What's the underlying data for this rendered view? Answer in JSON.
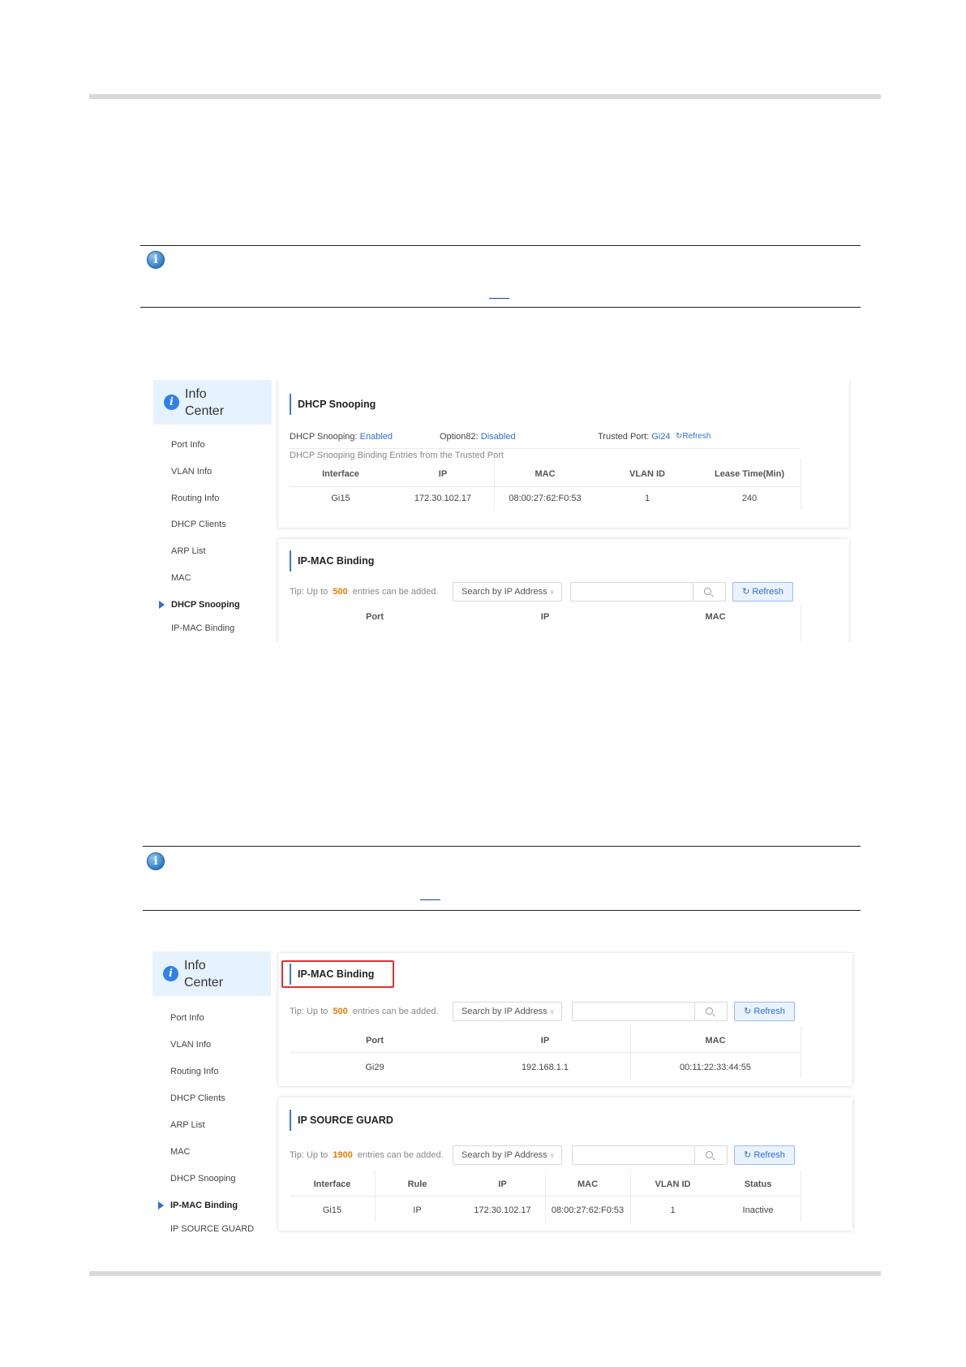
{
  "shot1": {
    "sidebar": {
      "title": "Info Center",
      "items": [
        "Port Info",
        "VLAN Info",
        "Routing Info",
        "DHCP Clients",
        "ARP List",
        "MAC",
        "DHCP Snooping",
        "IP-MAC Binding"
      ],
      "active": "DHCP Snooping"
    },
    "dhcp": {
      "title": "DHCP Snooping",
      "status_label": "DHCP Snooping:",
      "status_value": "Enabled",
      "option82_label": "Option82:",
      "option82_value": "Disabled",
      "trusted_label": "Trusted Port:",
      "trusted_value": "Gi24",
      "refresh": "Refresh",
      "subtitle": "DHCP Snooping Binding Entries from the Trusted Port",
      "columns": [
        "Interface",
        "IP",
        "MAC",
        "VLAN ID",
        "Lease Time(Min)"
      ],
      "rows": [
        [
          "Gi15",
          "172.30.102.17",
          "08:00:27:62:F0:53",
          "1",
          "240"
        ]
      ]
    },
    "ipmac": {
      "title": "IP-MAC Binding",
      "tip_prefix": "Tip: Up to",
      "tip_count": "500",
      "tip_suffix": "entries can be added.",
      "search_select": "Search by IP Address",
      "refresh": "Refresh",
      "columns": [
        "Port",
        "IP",
        "MAC"
      ]
    }
  },
  "shot2": {
    "sidebar": {
      "title": "Info Center",
      "items": [
        "Port Info",
        "VLAN Info",
        "Routing Info",
        "DHCP Clients",
        "ARP List",
        "MAC",
        "DHCP Snooping",
        "IP-MAC Binding",
        "IP SOURCE GUARD"
      ],
      "active": "IP-MAC Binding"
    },
    "ipmac": {
      "title": "IP-MAC Binding",
      "tip_prefix": "Tip: Up to",
      "tip_count": "500",
      "tip_suffix": "entries can be added.",
      "search_select": "Search by IP Address",
      "refresh": "Refresh",
      "columns": [
        "Port",
        "IP",
        "MAC"
      ],
      "rows": [
        [
          "Gi29",
          "192.168.1.1",
          "00:11:22:33:44:55"
        ]
      ]
    },
    "isg": {
      "title": "IP SOURCE GUARD",
      "tip_prefix": "Tip: Up to",
      "tip_count": "1900",
      "tip_suffix": "entries can be added.",
      "search_select": "Search by IP Address",
      "refresh": "Refresh",
      "columns": [
        "Interface",
        "Rule",
        "IP",
        "MAC",
        "VLAN ID",
        "Status"
      ],
      "rows": [
        [
          "Gi15",
          "IP",
          "172.30.102.17",
          "08:00:27:62:F0:53",
          "1",
          "Inactive"
        ]
      ]
    }
  },
  "colors": {
    "accent": "#2f6fd6",
    "highlight": "#e0302e",
    "tip_count": "#f07a00"
  }
}
